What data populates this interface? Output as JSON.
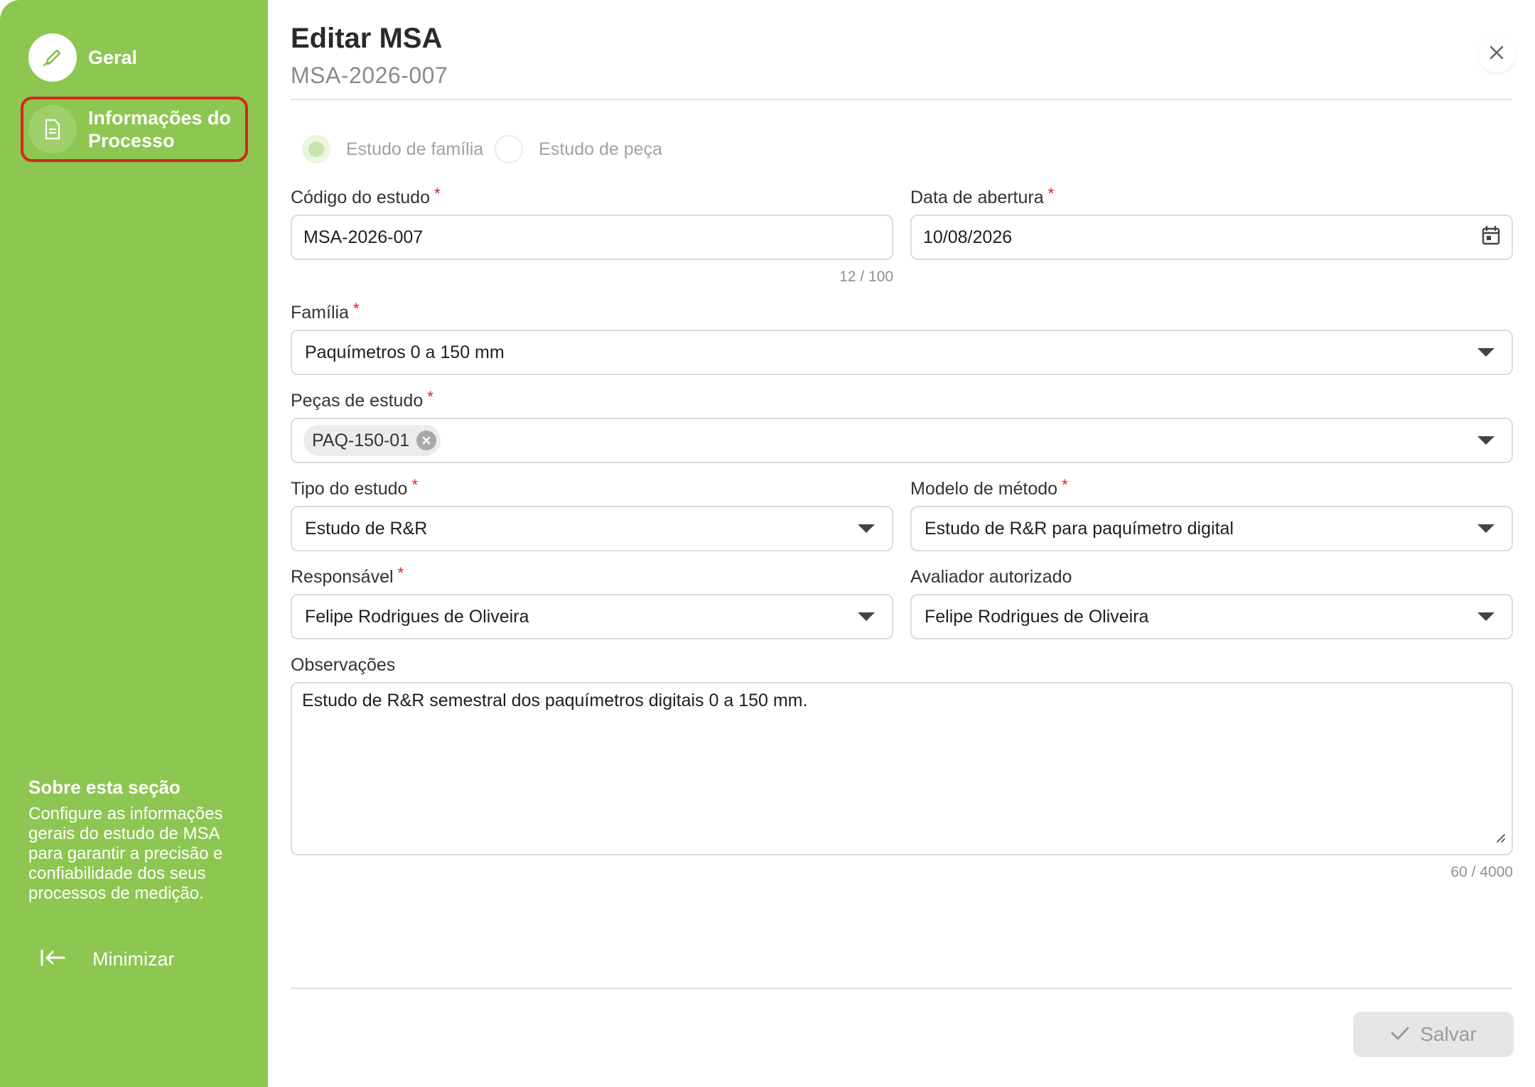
{
  "sidebar": {
    "items": [
      {
        "label": "Geral",
        "icon": "pen-icon"
      },
      {
        "label": "Informações do Processo",
        "icon": "document-icon"
      }
    ],
    "about": {
      "title": "Sobre esta seção",
      "text": "Configure as informações gerais do estudo de MSA para garantir a precisão e confiabilidade dos seus processos de medição."
    },
    "minimize_label": "Minimizar"
  },
  "header": {
    "title": "Editar MSA",
    "subtitle": "MSA-2026-007"
  },
  "form": {
    "study_type_options": [
      {
        "label": "Estudo de família",
        "checked": true
      },
      {
        "label": "Estudo de peça",
        "checked": false
      }
    ],
    "study_code": {
      "label": "Código do estudo",
      "value": "MSA-2026-007",
      "counter": "12 / 100"
    },
    "open_date": {
      "label": "Data de abertura",
      "value": "10/08/2026"
    },
    "family": {
      "label": "Família",
      "value": "Paquímetros 0 a 150 mm"
    },
    "parts": {
      "label": "Peças de estudo",
      "chips": [
        "PAQ-150-01"
      ]
    },
    "study_kind": {
      "label": "Tipo do estudo",
      "value": "Estudo de R&R"
    },
    "method_model": {
      "label": "Modelo de método",
      "value": "Estudo de R&R para paquímetro digital"
    },
    "responsible": {
      "label": "Responsável",
      "value": "Felipe Rodrigues de Oliveira"
    },
    "authorized_evaluator": {
      "label": "Avaliador autorizado",
      "value": "Felipe Rodrigues de Oliveira"
    },
    "notes": {
      "label": "Observações",
      "value": "Estudo de R&R semestral dos paquímetros digitais 0 a 150 mm.",
      "counter": "60 / 4000"
    },
    "required_marker": "*"
  },
  "footer": {
    "save_label": "Salvar"
  },
  "colors": {
    "sidebar": "#8dc651",
    "highlight": "#d4271b",
    "required": "#e01e1e"
  }
}
